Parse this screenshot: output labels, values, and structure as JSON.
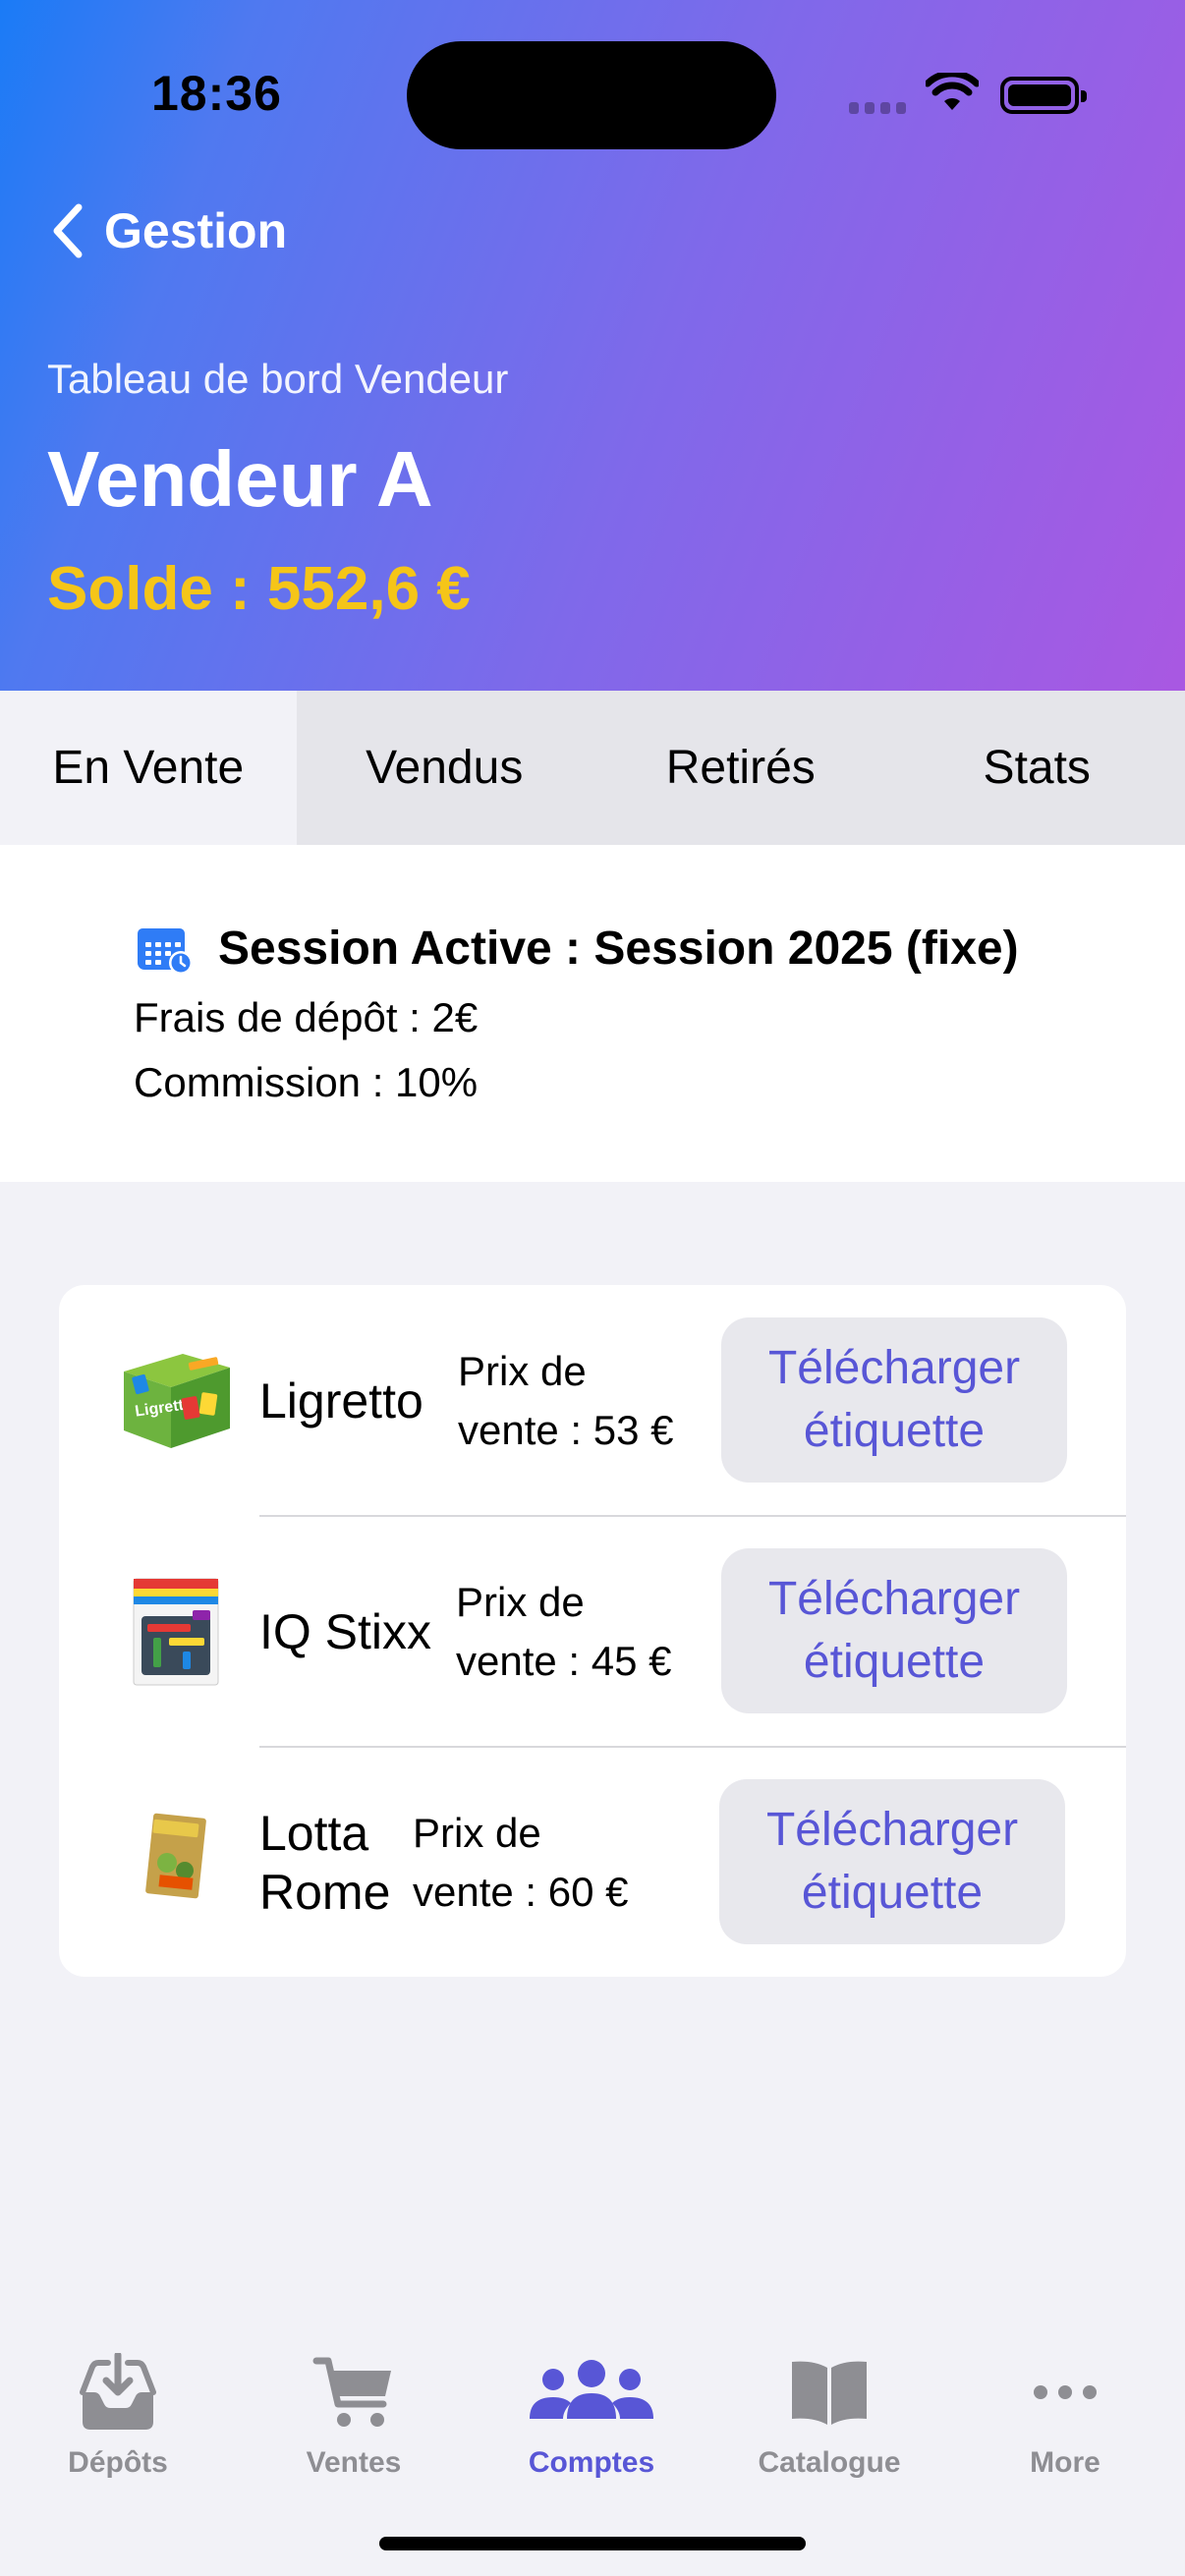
{
  "status_bar": {
    "time": "18:36"
  },
  "nav": {
    "back_label": "Gestion"
  },
  "header": {
    "subtitle": "Tableau de bord Vendeur",
    "title": "Vendeur A",
    "balance": "Solde : 552,6 €"
  },
  "tabs": [
    {
      "label": "En Vente",
      "active": true
    },
    {
      "label": "Vendus",
      "active": false
    },
    {
      "label": "Retirés",
      "active": false
    },
    {
      "label": "Stats",
      "active": false
    }
  ],
  "session": {
    "title": "Session Active : Session 2025 (fixe)",
    "fee": "Frais de dépôt : 2€",
    "commission": "Commission : 10%"
  },
  "items": [
    {
      "name": "Ligretto",
      "price": "Prix de vente : 53 €",
      "price_line1": "Prix de",
      "price_line2": "vente : 53 €",
      "button": "Télécharger étiquette",
      "button_line1": "Télécharger",
      "button_line2": "étiquette"
    },
    {
      "name": "IQ Stixx",
      "price": "Prix de vente : 45 €",
      "price_line1": "Prix de",
      "price_line2": "vente : 45 €",
      "button": "Télécharger étiquette",
      "button_line1": "Télécharger",
      "button_line2": "étiquette"
    },
    {
      "name": "Lotta Rome",
      "name_line1": "Lotta",
      "name_line2": "Rome",
      "price": "Prix de vente : 60 €",
      "price_line1": "Prix de",
      "price_line2": "vente : 60 €",
      "button": "Télécharger étiquette",
      "button_line1": "Télécharger",
      "button_line2": "étiquette"
    }
  ],
  "tabbar": [
    {
      "label": "Dépôts",
      "icon": "tray-download-icon",
      "active": false
    },
    {
      "label": "Ventes",
      "icon": "cart-icon",
      "active": false
    },
    {
      "label": "Comptes",
      "icon": "people-icon",
      "active": true
    },
    {
      "label": "Catalogue",
      "icon": "book-icon",
      "active": false
    },
    {
      "label": "More",
      "icon": "more-dots-icon",
      "active": false
    }
  ],
  "colors": {
    "accent": "#5856D6",
    "balance": "#F5C518",
    "gradient_start": "#1A7BF6",
    "gradient_end": "#A958E2"
  }
}
